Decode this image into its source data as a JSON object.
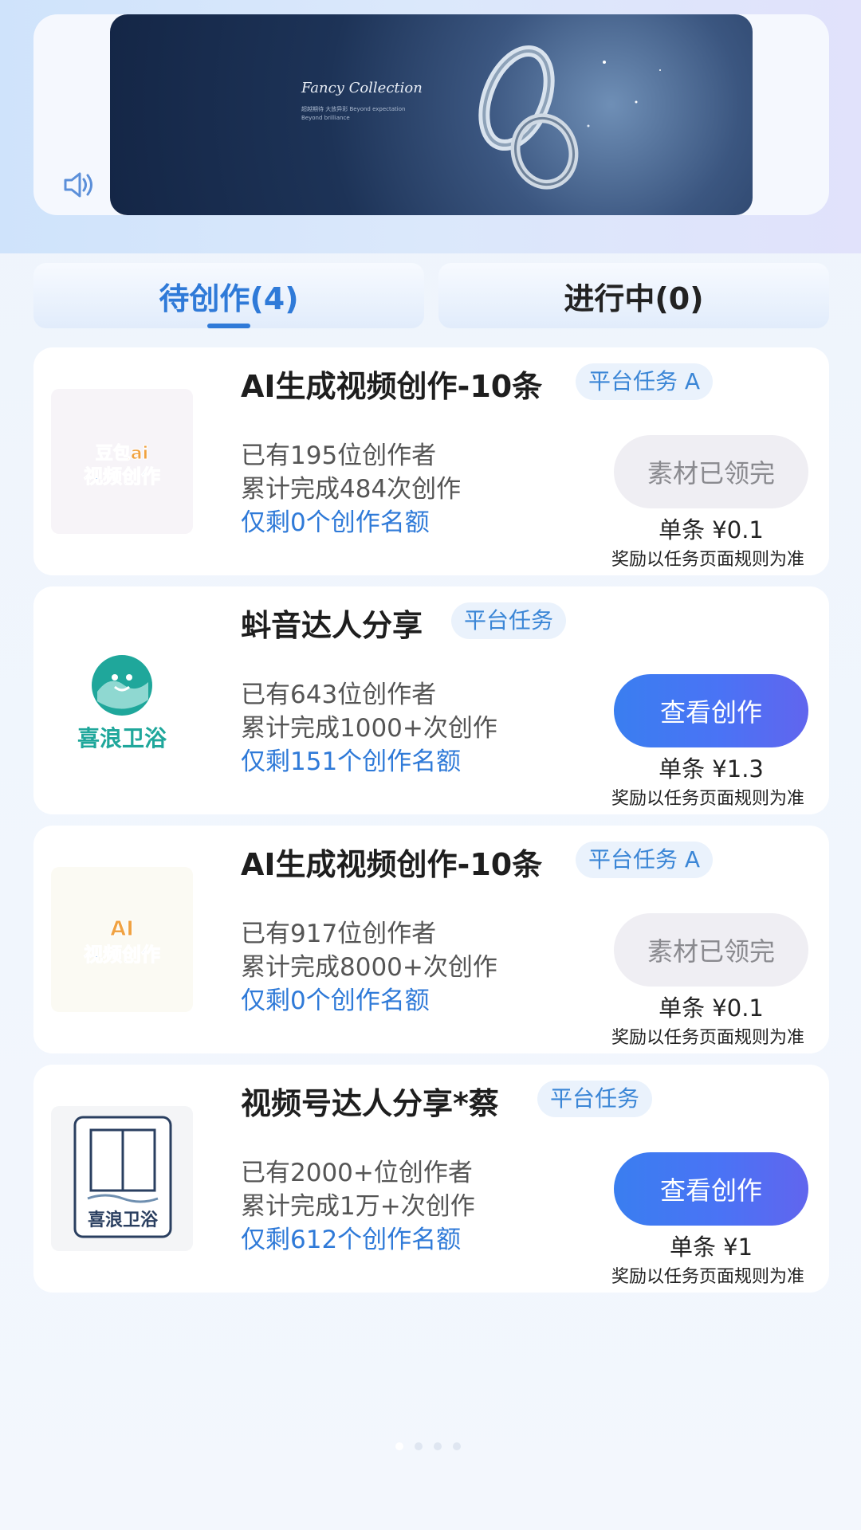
{
  "banner": {
    "title": "Fancy Collection",
    "subtitle": "超越期待 大放异彩 Beyond expectation Beyond brilliance"
  },
  "tabs": [
    {
      "label": "待创作(4)",
      "active": true
    },
    {
      "label": "进行中(0)",
      "active": false
    }
  ],
  "tasks": [
    {
      "thumb_text": "豆包ai视频创作",
      "title": "AI生成视频创作-10条",
      "tag": "平台任务 A",
      "creators": "已有195位创作者",
      "completed": "累计完成484次创作",
      "remaining": "仅剩0个创作名额",
      "button": "素材已领完",
      "button_state": "disabled",
      "price": "单条 ¥0.1",
      "note": "奖励以任务页面规则为准"
    },
    {
      "thumb_text": "喜浪卫浴",
      "title": "蚪音达人分享",
      "tag": "平台任务",
      "creators": "已有643位创作者",
      "completed": "累计完成1000+次创作",
      "remaining": "仅剩151个创作名额",
      "button": "查看创作",
      "button_state": "active",
      "price": "单条 ¥1.3",
      "note": "奖励以任务页面规则为准"
    },
    {
      "thumb_text": "AI视频创作",
      "title": "AI生成视频创作-10条",
      "tag": "平台任务 A",
      "creators": "已有917位创作者",
      "completed": "累计完成8000+次创作",
      "remaining": "仅剩0个创作名额",
      "button": "素材已领完",
      "button_state": "disabled",
      "price": "单条 ¥0.1",
      "note": "奖励以任务页面规则为准"
    },
    {
      "thumb_text": "喜浪卫浴",
      "title": "视频号达人分享*蔡",
      "tag": "平台任务",
      "creators": "已有2000+位创作者",
      "completed": "累计完成1万+次创作",
      "remaining": "仅剩612个创作名额",
      "button": "查看创作",
      "button_state": "active",
      "price": "单条 ¥1",
      "note": "奖励以任务页面规则为准"
    }
  ],
  "colors": {
    "accent": "#2f7ad8",
    "button_gradient_start": "#3a7ef0",
    "button_gradient_end": "#6165ee",
    "disabled_bg": "#efeef3"
  },
  "icons": {
    "speaker": "speaker-icon"
  }
}
